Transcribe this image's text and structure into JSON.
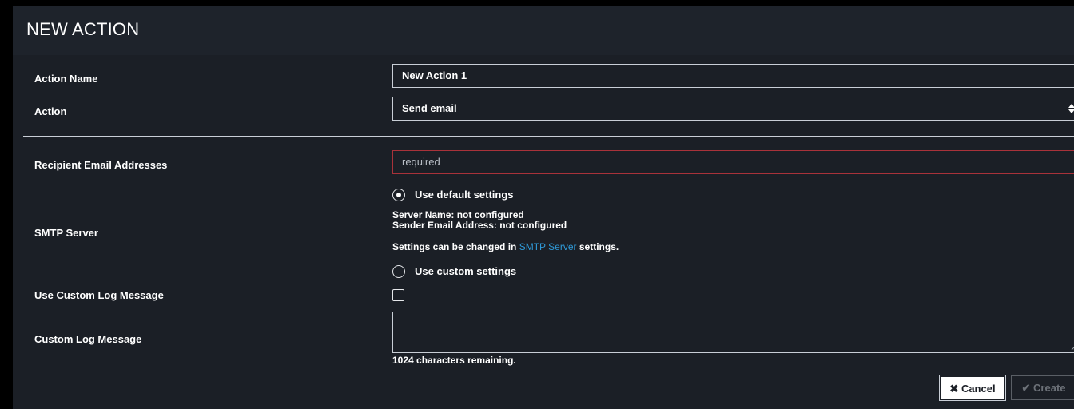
{
  "dialog": {
    "title": "NEW ACTION"
  },
  "form": {
    "action_name_label": "Action Name",
    "action_name_value": "New Action 1",
    "action_label": "Action",
    "action_value": "Send email",
    "recipients_label": "Recipient Email Addresses",
    "recipients_placeholder": "required",
    "smtp_label": "SMTP Server",
    "smtp_default_option": "Use default settings",
    "smtp_default_selected": true,
    "server_name_line": "Server Name: not configured",
    "sender_email_line": "Sender Email Address: not configured",
    "settings_prefix": "Settings can be changed in",
    "settings_link": "SMTP Server",
    "settings_suffix": "settings.",
    "smtp_custom_option": "Use custom settings",
    "custom_log_label": "Use Custom Log Message",
    "custom_log_checked": false,
    "custom_log_message_label": "Custom Log Message",
    "custom_log_message_value": "",
    "chars_remaining": "1024 characters remaining."
  },
  "buttons": {
    "cancel_label": "Cancel",
    "create_label": "Create",
    "cancel_icon": "x-icon",
    "create_icon": "check-icon"
  },
  "colors": {
    "background": "#1b1f26",
    "link": "#2f9ad8",
    "invalid_border": "#a9323a"
  }
}
